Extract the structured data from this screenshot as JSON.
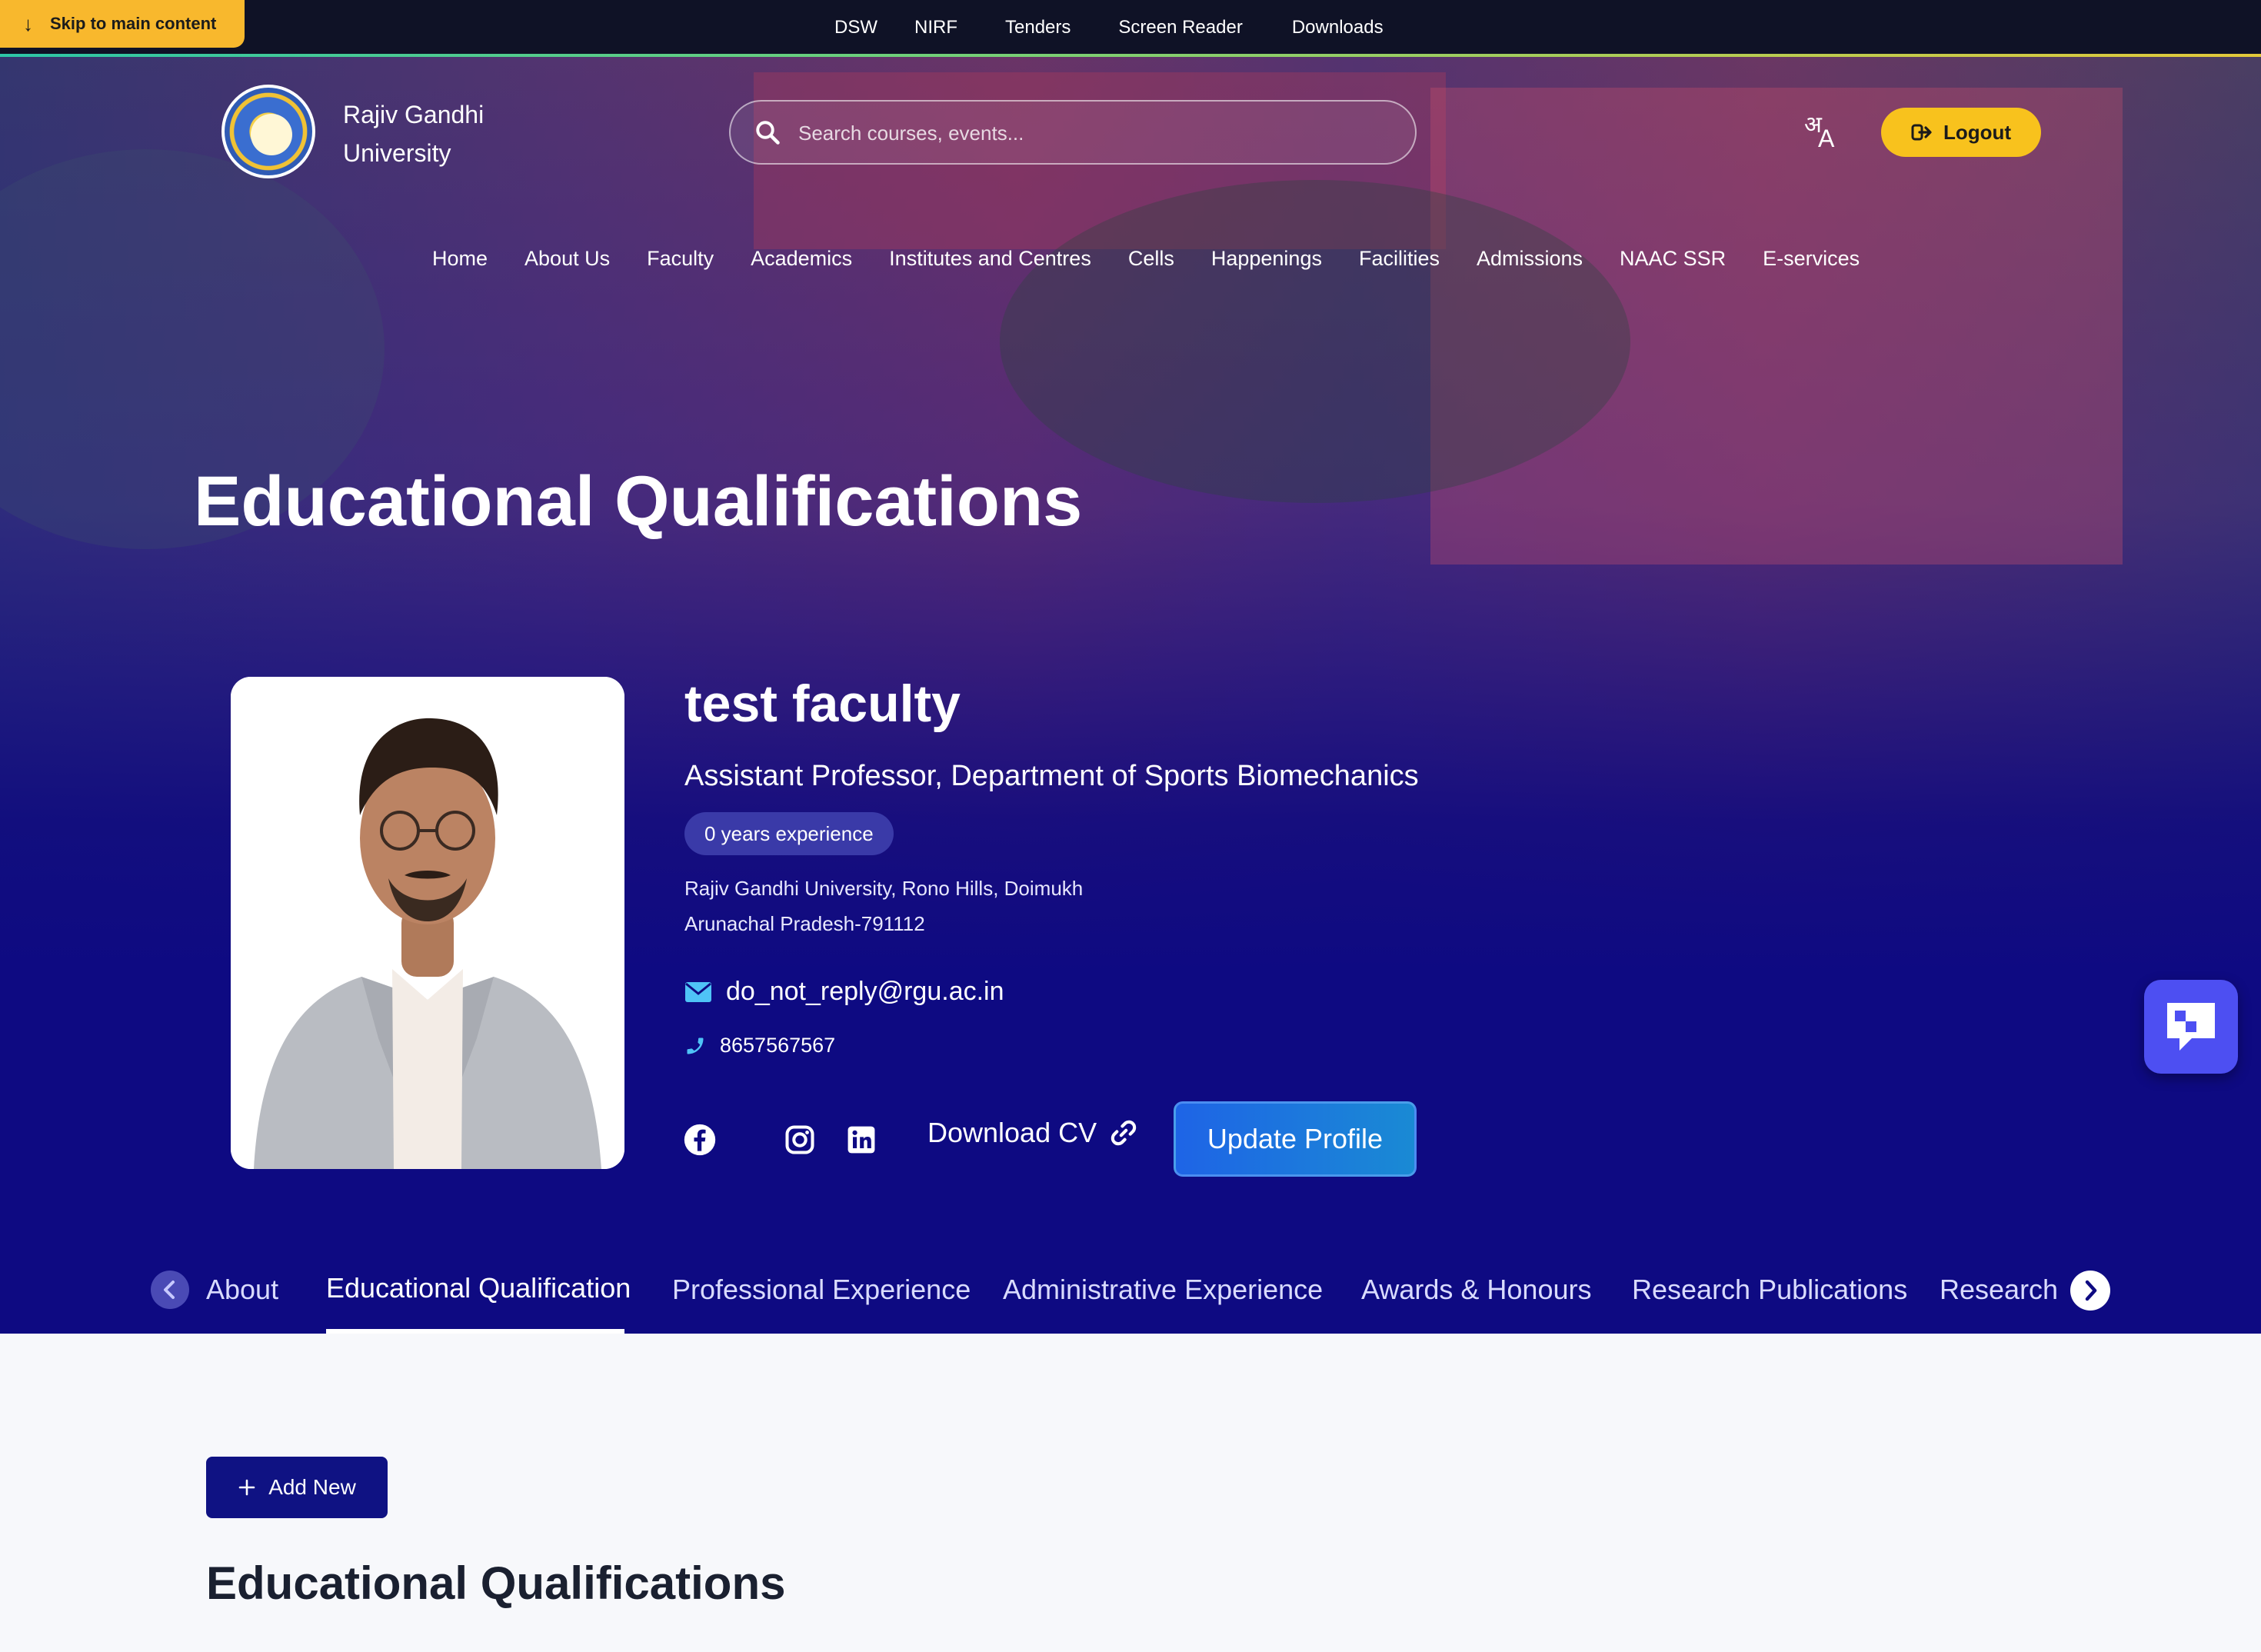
{
  "skip_link": "Skip to main content",
  "top_links": [
    "DSW",
    "NIRF",
    "Tenders",
    "Screen Reader",
    "Downloads"
  ],
  "brand": {
    "line1": "Rajiv Gandhi",
    "line2": "University"
  },
  "search": {
    "placeholder": "Search courses, events..."
  },
  "language_toggle": {
    "hindi": "अ",
    "english": "A"
  },
  "logout_label": "Logout",
  "main_nav": [
    "Home",
    "About Us",
    "Faculty",
    "Academics",
    "Institutes and Centres",
    "Cells",
    "Happenings",
    "Facilities",
    "Admissions",
    "NAAC SSR",
    "E-services"
  ],
  "hero_title": "Educational Qualifications",
  "profile": {
    "name": "test faculty",
    "designation": "Assistant Professor, Department of Sports Biomechanics",
    "experience_badge": "0 years experience",
    "address_line1": "Rajiv Gandhi University, Rono Hills, Doimukh",
    "address_line2": "Arunachal Pradesh-791112",
    "email": "do_not_reply@rgu.ac.in",
    "phone": "8657567567",
    "download_cv": "Download CV",
    "update_profile": "Update Profile"
  },
  "tabs": [
    "About",
    "Educational Qualification",
    "Professional Experience",
    "Administrative Experience",
    "Awards & Honours",
    "Research Publications",
    "Research"
  ],
  "active_tab": "Educational Qualification",
  "content": {
    "add_new": "Add New",
    "section_title": "Educational Qualifications"
  },
  "colors": {
    "hero_navy": "#0e0a82",
    "accent_yellow": "#f8c21d",
    "update_blue": "#1e64e6",
    "chat_purple": "#4d4ff2"
  }
}
